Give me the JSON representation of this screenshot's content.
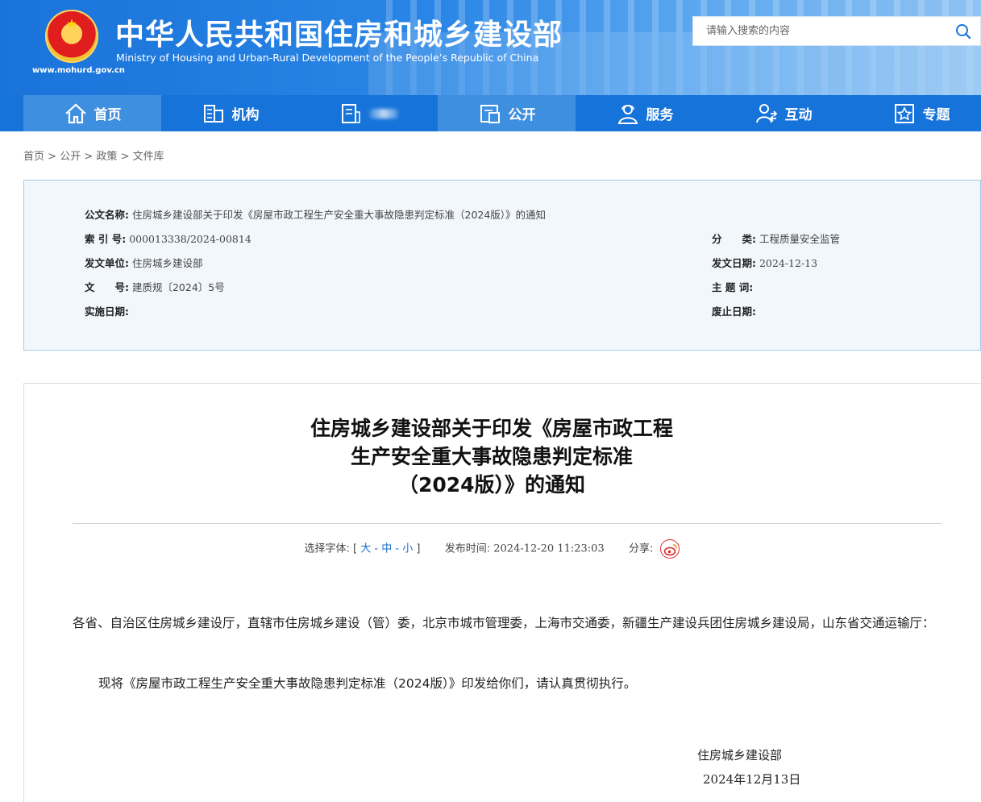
{
  "header": {
    "title": "中华人民共和国住房和城乡建设部",
    "subtitle": "Ministry of Housing and Urban-Rural Development of the People’s Republic of China",
    "url": "www.mohurd.gov.cn",
    "search_placeholder": "请输入搜索的内容"
  },
  "nav": {
    "items": [
      {
        "label": "首页",
        "icon": "home-icon",
        "active": true
      },
      {
        "label": "机构",
        "icon": "building-icon"
      },
      {
        "label": "",
        "icon": "document-icon"
      },
      {
        "label": "公开",
        "icon": "folder-open-icon",
        "active": true
      },
      {
        "label": "服务",
        "icon": "service-person-icon"
      },
      {
        "label": "互动",
        "icon": "interaction-icon"
      },
      {
        "label": "专题",
        "icon": "star-box-icon"
      }
    ]
  },
  "breadcrumb": [
    "首页",
    "公开",
    "政策",
    "文件库"
  ],
  "breadcrumb_sep": ">",
  "meta": {
    "doc_name_label": "公文名称:",
    "doc_name": "住房城乡建设部关于印发《房屋市政工程生产安全重大事故隐患判定标准（2024版）》的通知",
    "index_label": "索 引 号:",
    "index": "000013338/2024-00814",
    "category_label": "分　　类:",
    "category": "工程质量安全监管",
    "issuer_label": "发文单位:",
    "issuer": "住房城乡建设部",
    "issue_date_label": "发文日期:",
    "issue_date": "2024-12-13",
    "doc_no_label": "文　　号:",
    "doc_no": "建质规〔2024〕5号",
    "keywords_label": "主 题 词:",
    "keywords": "",
    "effective_label": "实施日期:",
    "effective": "",
    "expiry_label": "废止日期:",
    "expiry": ""
  },
  "article": {
    "title_lines": [
      "住房城乡建设部关于印发《房屋市政工程",
      "生产安全重大事故隐患判定标准",
      "（2024版）》的通知"
    ],
    "font_label": "选择字体:",
    "font_open": "[",
    "font_large": "大",
    "font_dash": "-",
    "font_medium": "中",
    "font_small": "小",
    "font_close": "]",
    "publish_label": "发布时间:",
    "publish_time": "2024-12-20 11:23:03",
    "share_label": "分享:",
    "para1": "各省、自治区住房城乡建设厅，直辖市住房城乡建设（管）委，北京市城市管理委，上海市交通委，新疆生产建设兵团住房城乡建设局，山东省交通运输厅：",
    "para2": "现将《房屋市政工程生产安全重大事故隐患判定标准（2024版）》印发给你们，请认真贯彻执行。",
    "signature": "住房城乡建设部",
    "sign_date": "2024年12月13日"
  },
  "colors": {
    "nav_bg": "#1673d9",
    "nav_active": "#3f8fe0",
    "meta_bg": "#f2f7fc",
    "meta_border": "#a9cbe9",
    "link_blue": "#1a6fcf"
  }
}
